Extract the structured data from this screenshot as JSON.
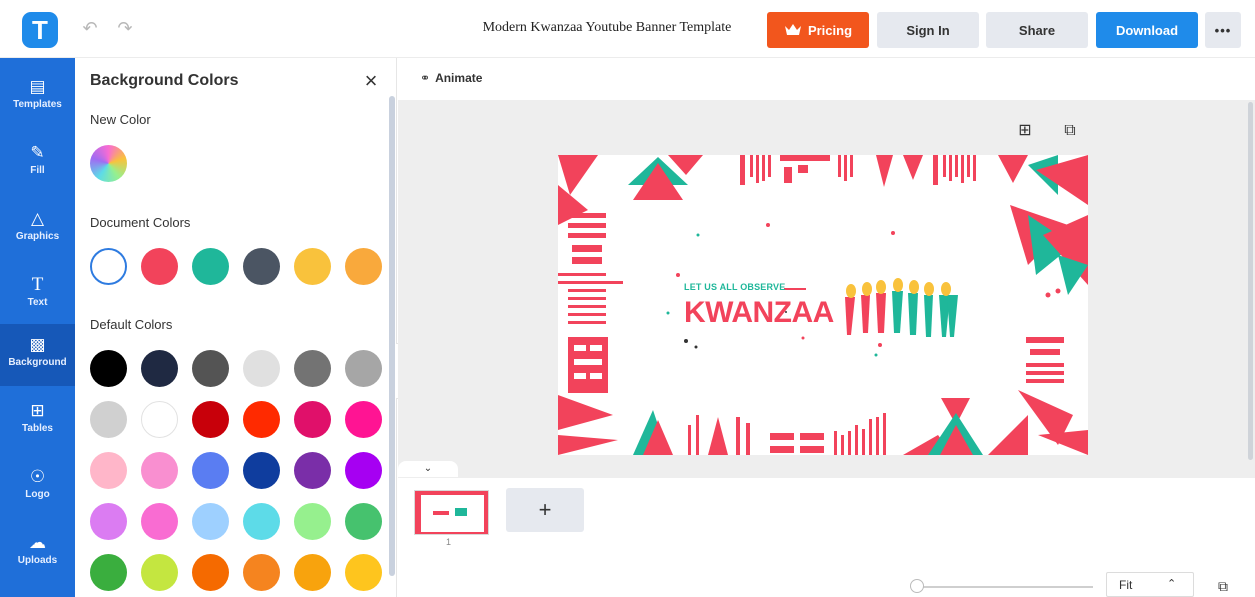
{
  "header": {
    "logo_letter": "T",
    "undo_icon": "undo-icon",
    "redo_icon": "redo-icon",
    "title": "Modern Kwanzaa Youtube Banner Template",
    "pricing_label": "Pricing",
    "signin_label": "Sign In",
    "share_label": "Share",
    "download_label": "Download",
    "more_label": "•••",
    "accent_orange": "#f2561d",
    "accent_blue": "#1f8bea"
  },
  "sidebar": {
    "items": [
      {
        "label": "Templates",
        "icon": "templates-icon"
      },
      {
        "label": "Fill",
        "icon": "pencil-icon"
      },
      {
        "label": "Graphics",
        "icon": "shapes-icon"
      },
      {
        "label": "Text",
        "icon": "text-icon"
      },
      {
        "label": "Background",
        "icon": "background-icon",
        "active": true
      },
      {
        "label": "Tables",
        "icon": "table-icon"
      },
      {
        "label": "Logo",
        "icon": "logo-icon"
      },
      {
        "label": "Uploads",
        "icon": "upload-icon"
      }
    ]
  },
  "panel": {
    "title": "Background Colors",
    "new_color_label": "New Color",
    "document_colors_label": "Document Colors",
    "default_colors_label": "Default Colors",
    "document_colors": [
      "#ffffff",
      "#f2435b",
      "#1fb79a",
      "#4b5563",
      "#f9c23c",
      "#f9a93c"
    ],
    "default_colors": [
      "#000000",
      "#1f2942",
      "#545454",
      "#e0e0e0",
      "#737373",
      "#a6a6a6",
      "#d0d0d0",
      "#ffffff",
      "#c8000a",
      "#ff2a00",
      "#e0106a",
      "#ff1493",
      "#ffb6c9",
      "#f98fd0",
      "#5a7df2",
      "#0f3d9e",
      "#7a2ea8",
      "#a600f2",
      "#db7cf2",
      "#f96cd2",
      "#9ed0ff",
      "#5ddbe8",
      "#96f08e",
      "#46c26e",
      "#3aae3e",
      "#c4e640",
      "#f56a00",
      "#f5841f",
      "#f8a30d",
      "#fec51e"
    ]
  },
  "workspace": {
    "animate_label": "Animate",
    "banner": {
      "small_text": "LET US ALL OBSERVE",
      "big_text": "KWANZAA",
      "pink": "#f2435b",
      "green": "#1fb79a",
      "yellow": "#f9c23c"
    }
  },
  "pages": {
    "page_number": "1",
    "add_label": "+",
    "zoom_value": "Fit"
  }
}
